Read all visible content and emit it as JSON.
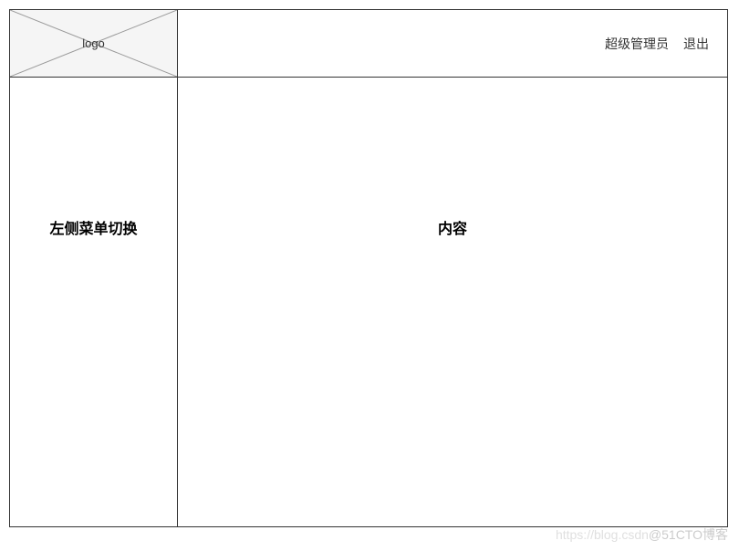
{
  "header": {
    "logo_label": "logo",
    "user_label": "超级管理员",
    "logout_label": "退出"
  },
  "sidebar": {
    "label": "左侧菜单切换"
  },
  "main": {
    "content_label": "内容"
  },
  "watermark": {
    "faint": "https://blog.csdn",
    "text": "@51CTO博客"
  }
}
